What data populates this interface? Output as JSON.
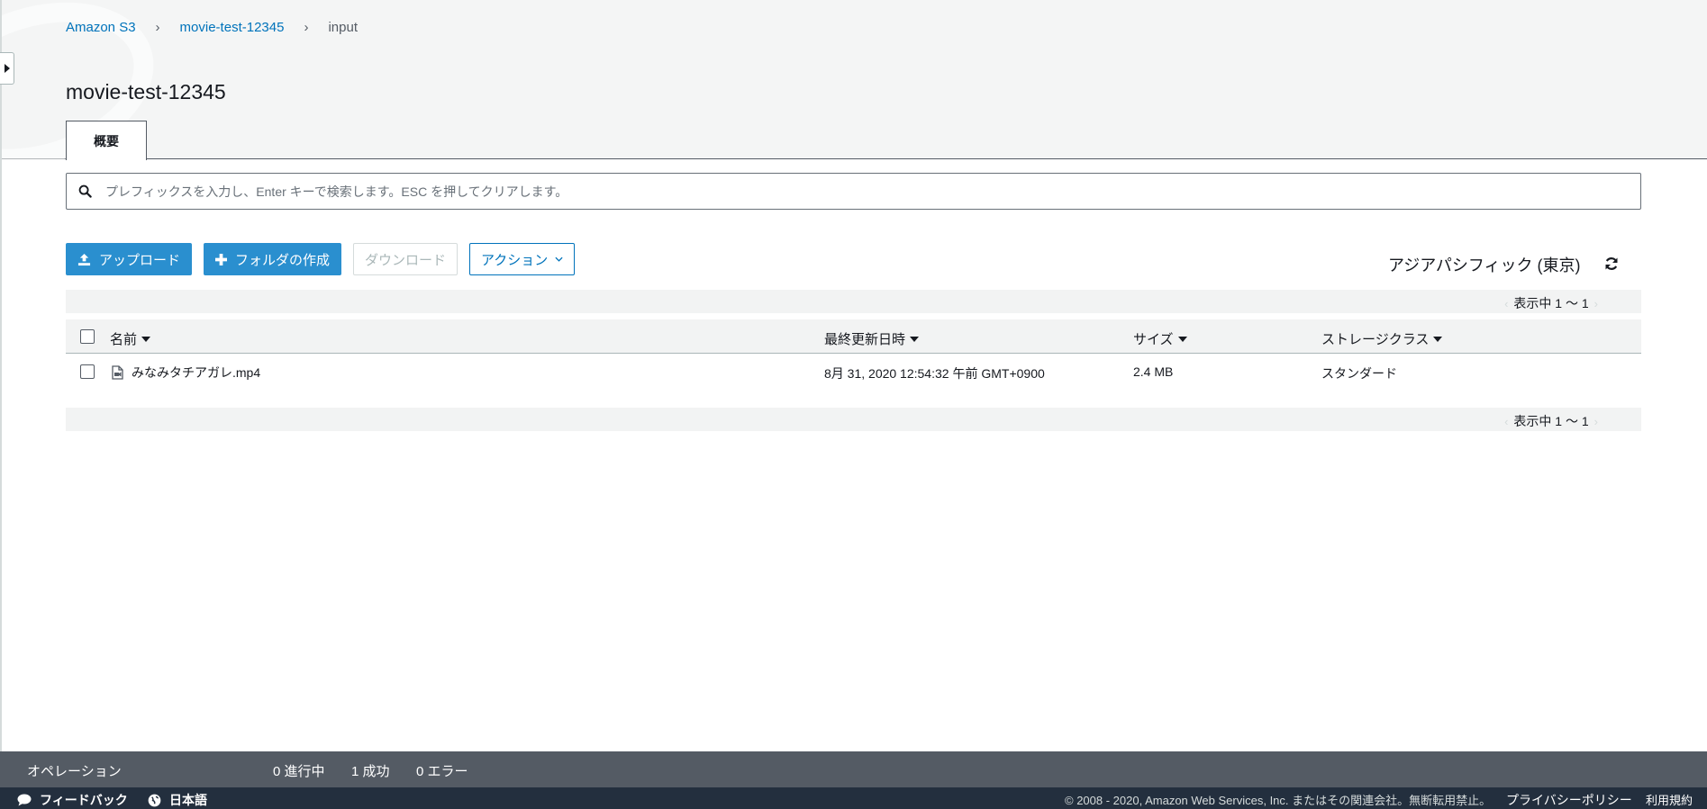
{
  "breadcrumb": {
    "root": "Amazon S3",
    "bucket": "movie-test-12345",
    "folder": "input"
  },
  "page_title": "movie-test-12345",
  "tab": {
    "label": "概要"
  },
  "search": {
    "placeholder": "プレフィックスを入力し、Enter キーで検索します。ESC を押してクリアします。",
    "value": ""
  },
  "toolbar": {
    "upload": "アップロード",
    "create_folder": "フォルダの作成",
    "download": "ダウンロード",
    "actions": "アクション"
  },
  "region": "アジアパシフィック (東京)",
  "pager": {
    "top": "表示中 1 ～ 1",
    "bottom": "表示中 1 ～ 1"
  },
  "table": {
    "columns": {
      "name": "名前",
      "modified": "最終更新日時",
      "size": "サイズ",
      "storage": "ストレージクラス"
    },
    "rows": [
      {
        "name": "みなみタチアガレ.mp4",
        "modified": "8月 31, 2020 12:54:32 午前 GMT+0900",
        "size": "2.4 MB",
        "storage": "スタンダード"
      }
    ]
  },
  "operations": {
    "label": "オペレーション",
    "in_progress": "0 進行中",
    "success": "1 成功",
    "error": "0 エラー"
  },
  "footer": {
    "feedback": "フィードバック",
    "language": "日本語",
    "copyright": "© 2008 - 2020, Amazon Web Services, Inc. またはその関連会社。無断転用禁止。",
    "privacy": "プライバシーポリシー",
    "terms": "利用規約"
  },
  "colors": {
    "accent": "#2a8fcf",
    "link": "#0073bb",
    "ops_bar": "#545b64",
    "footer": "#232f3e"
  },
  "icons": {
    "search": "search-icon",
    "upload": "upload-icon",
    "plus": "plus-icon",
    "chevron": "chevron-down-icon",
    "refresh": "refresh-icon",
    "file": "file-icon",
    "feedback": "speech-bubble-icon",
    "language": "globe-icon"
  }
}
